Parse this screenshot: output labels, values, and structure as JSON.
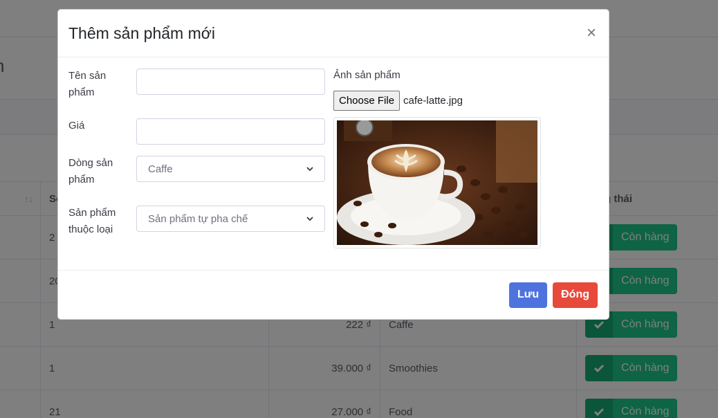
{
  "background": {
    "heading_fragment": "n",
    "table": {
      "header": {
        "sort_icon": "sort-icon",
        "col1": "Số",
        "col4": "g thái"
      },
      "rows": [
        {
          "num": "2",
          "price": "",
          "category": "",
          "status": "Còn hàng"
        },
        {
          "num": "20",
          "price": "",
          "category": "",
          "status": "Còn hàng"
        },
        {
          "num": "1",
          "price": "222 ₫",
          "category": "Caffe",
          "status": "Còn hàng"
        },
        {
          "num": "1",
          "price": "39.000 ₫",
          "category": "Smoothies",
          "status": "Còn hàng"
        },
        {
          "num": "21",
          "price": "27.000 ₫",
          "category": "Food",
          "status": "Còn hàng"
        }
      ]
    }
  },
  "modal": {
    "title": "Thêm sản phẩm mới",
    "close_label": "×",
    "fields": {
      "name_label": "Tên sản phẩm",
      "name_value": "",
      "price_label": "Giá",
      "price_value": "",
      "line_label": "Dòng sản phẩm",
      "line_selected": "Caffe",
      "type_label": "Sản phẩm thuộc loại",
      "type_selected": "Sản phẩm tự pha chế"
    },
    "image": {
      "label": "Ảnh sản phẩm",
      "choose_button": "Choose File",
      "file_name": "cafe-latte.jpg"
    },
    "footer": {
      "save_label": "Lưu",
      "close_label": "Đóng"
    }
  },
  "colors": {
    "primary": "#4e73df",
    "danger": "#e74a3b",
    "success": "#1cc88a"
  }
}
